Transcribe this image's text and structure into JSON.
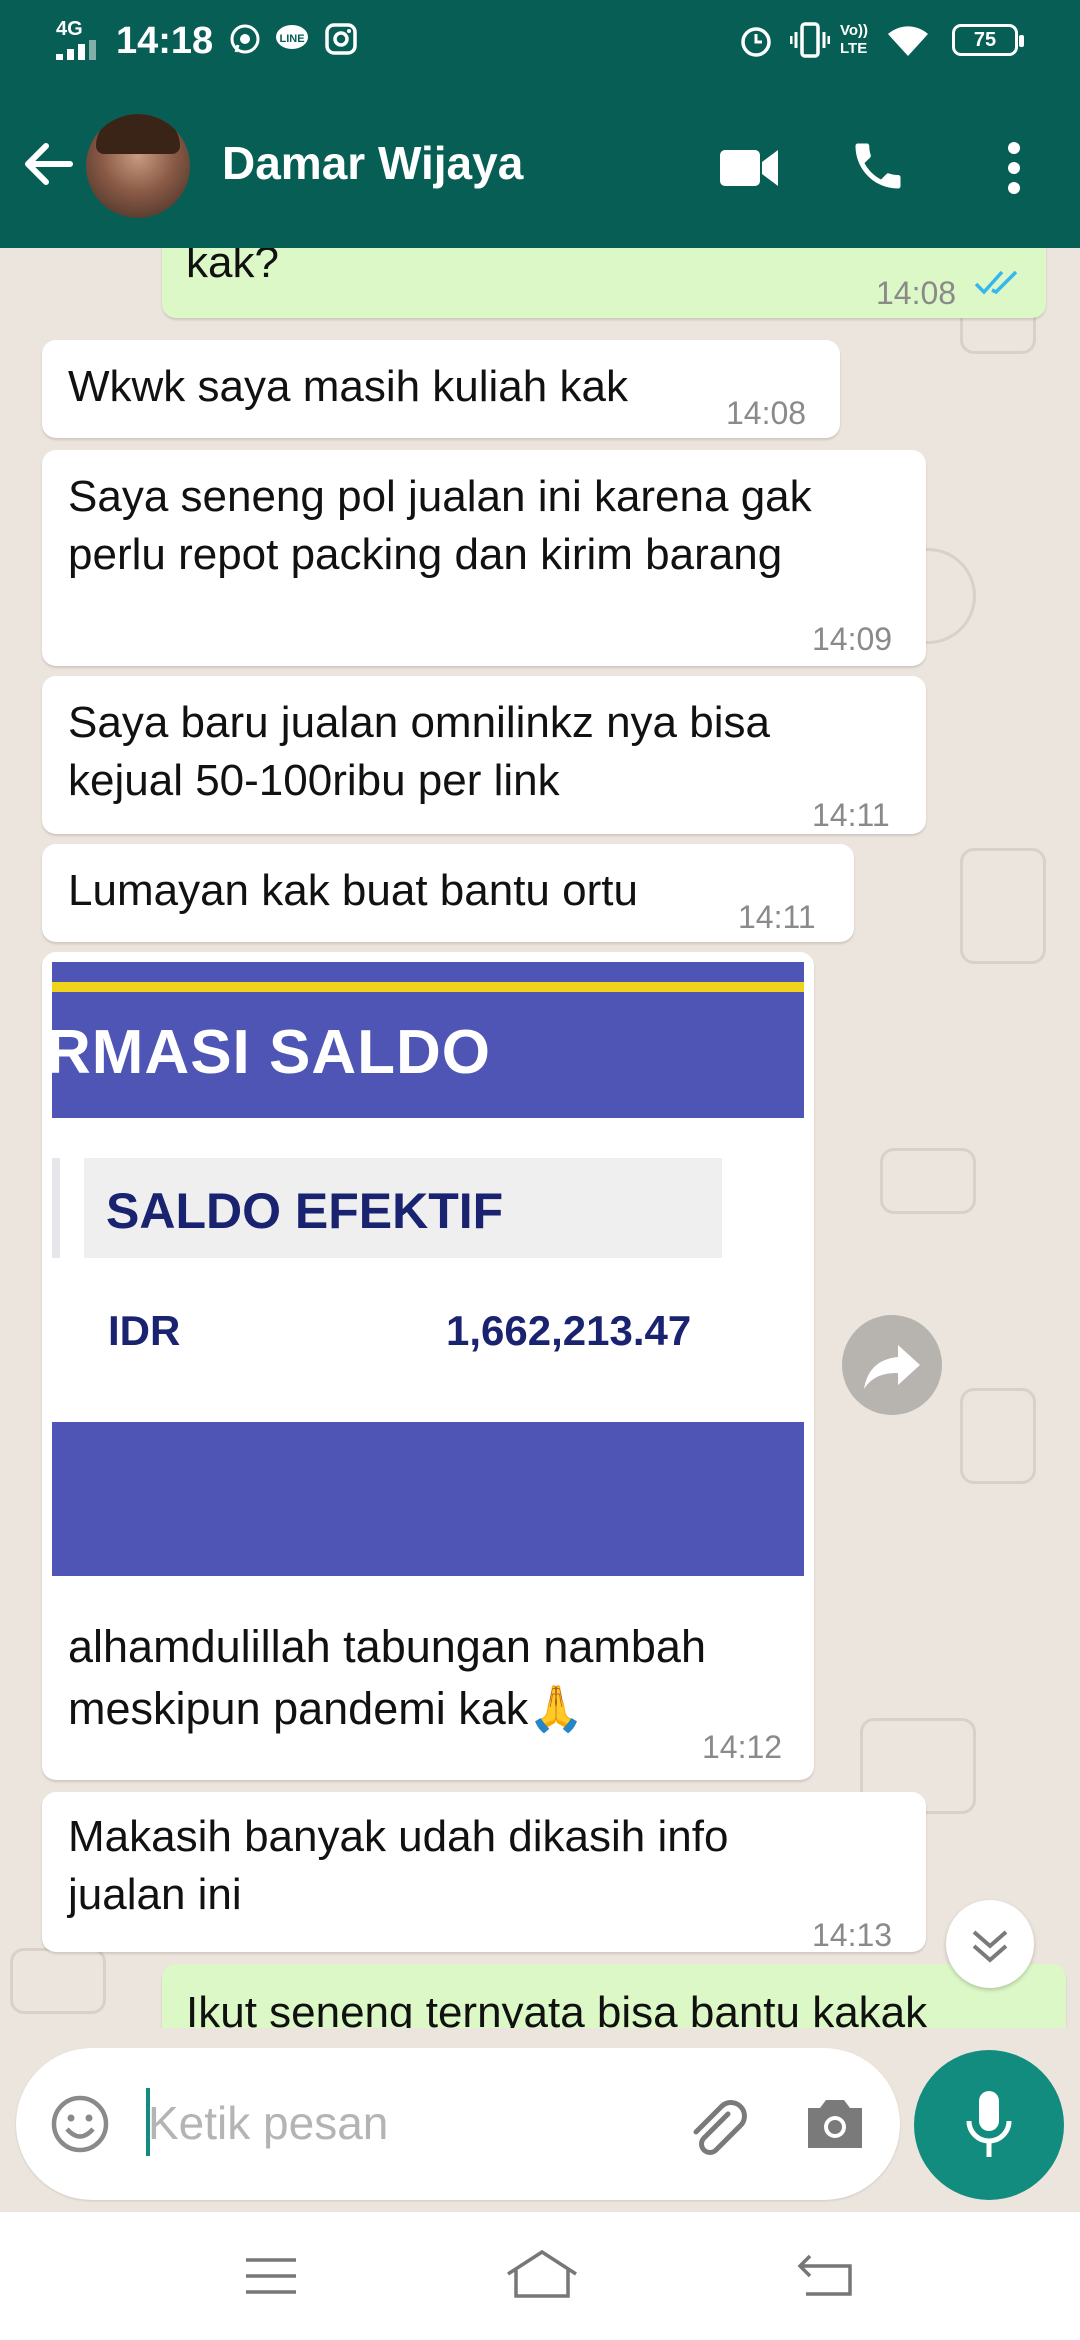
{
  "status_bar": {
    "time": "14:18",
    "network": "4G",
    "volte": "Vo)) LTE",
    "battery": "75",
    "icons": [
      "signal-icon",
      "whatsapp-icon",
      "line-icon",
      "instagram-icon",
      "alarm-icon",
      "vibrate-icon",
      "wifi-icon",
      "battery-icon"
    ]
  },
  "header": {
    "contact_name": "Damar Wijaya",
    "icons": [
      "back-arrow-icon",
      "video-call-icon",
      "phone-call-icon",
      "more-options-icon"
    ]
  },
  "messages": [
    {
      "direction": "out",
      "text": "kak?",
      "time": "14:08",
      "read": true
    },
    {
      "direction": "in",
      "text": "Wkwk saya masih kuliah kak",
      "time": "14:08"
    },
    {
      "direction": "in",
      "lines": [
        "Saya seneng pol jualan ini karena gak",
        "perlu repot packing dan kirim barang"
      ],
      "time": "14:09"
    },
    {
      "direction": "in",
      "lines": [
        "Saya baru jualan omnilinkz nya bisa",
        "kejual 50-100ribu per link"
      ],
      "time": "14:11"
    },
    {
      "direction": "in",
      "text": "Lumayan kak buat bantu ortu",
      "time": "14:11"
    },
    {
      "direction": "in",
      "image": {
        "heading": "RMASI SALDO",
        "box_label": "SALDO EFEKTIF",
        "currency": "IDR",
        "amount": "1,662,213.47"
      },
      "lines": [
        "alhamdulillah tabungan nambah",
        "meskipun pandemi kak🙏"
      ],
      "time": "14:12"
    },
    {
      "direction": "in",
      "lines": [
        "Makasih banyak udah dikasih info",
        "jualan ini"
      ],
      "time": "14:13"
    },
    {
      "direction": "out",
      "text": "Ikut seneng ternyata bisa bantu kakak"
    }
  ],
  "input": {
    "placeholder": "Ketik pesan",
    "icons": [
      "emoji-icon",
      "attach-icon",
      "camera-icon",
      "mic-icon"
    ]
  },
  "colors": {
    "header": "#075e54",
    "outgoing": "#dcf8c6",
    "incoming": "#ffffff",
    "accent": "#128c7e",
    "chat_bg": "#ece5dd",
    "saldo_blue": "#4f55b5",
    "saldo_yellow": "#f2d31b",
    "saldo_text": "#1a2370"
  }
}
